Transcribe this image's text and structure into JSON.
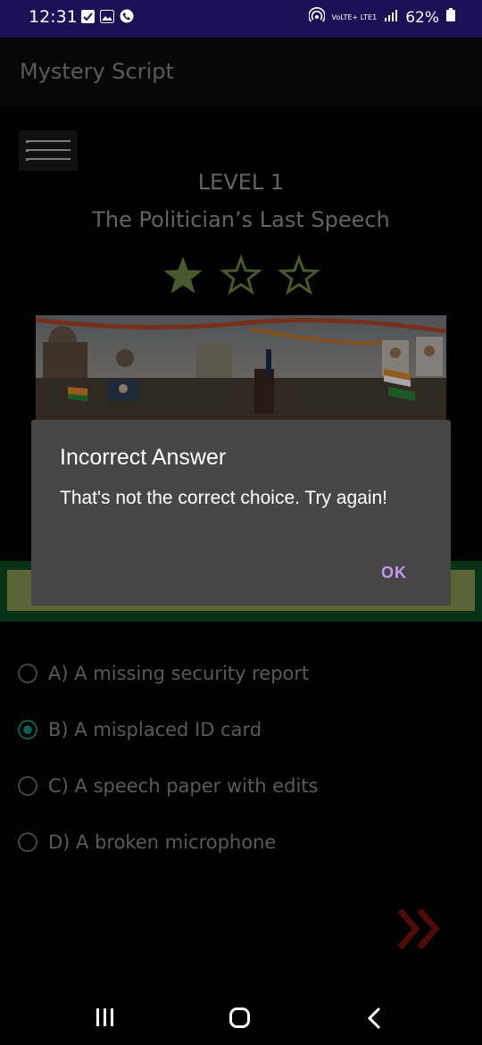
{
  "status_bar": {
    "time": "12:31",
    "lte": "VoLTE+ LTE1",
    "battery": "62%"
  },
  "app": {
    "title": "Mystery Script"
  },
  "level": {
    "label": "LEVEL 1",
    "title": "The Politician’s Last Speech",
    "stars_earned": 1,
    "stars_total": 3
  },
  "options": [
    {
      "label": "A) A missing security report",
      "selected": false
    },
    {
      "label": "B) A misplaced ID card",
      "selected": true
    },
    {
      "label": "C) A speech paper with edits",
      "selected": false
    },
    {
      "label": "D) A broken microphone",
      "selected": false
    }
  ],
  "dialog": {
    "title": "Incorrect Answer",
    "message": "That's not the correct choice. Try again!",
    "ok_label": "OK"
  },
  "colors": {
    "status_bar": "#1b0f55",
    "star": "#6f8a45",
    "accent_radio": "#1d8f80",
    "next_arrow": "#7a1010",
    "dialog_button": "#c49af0"
  }
}
